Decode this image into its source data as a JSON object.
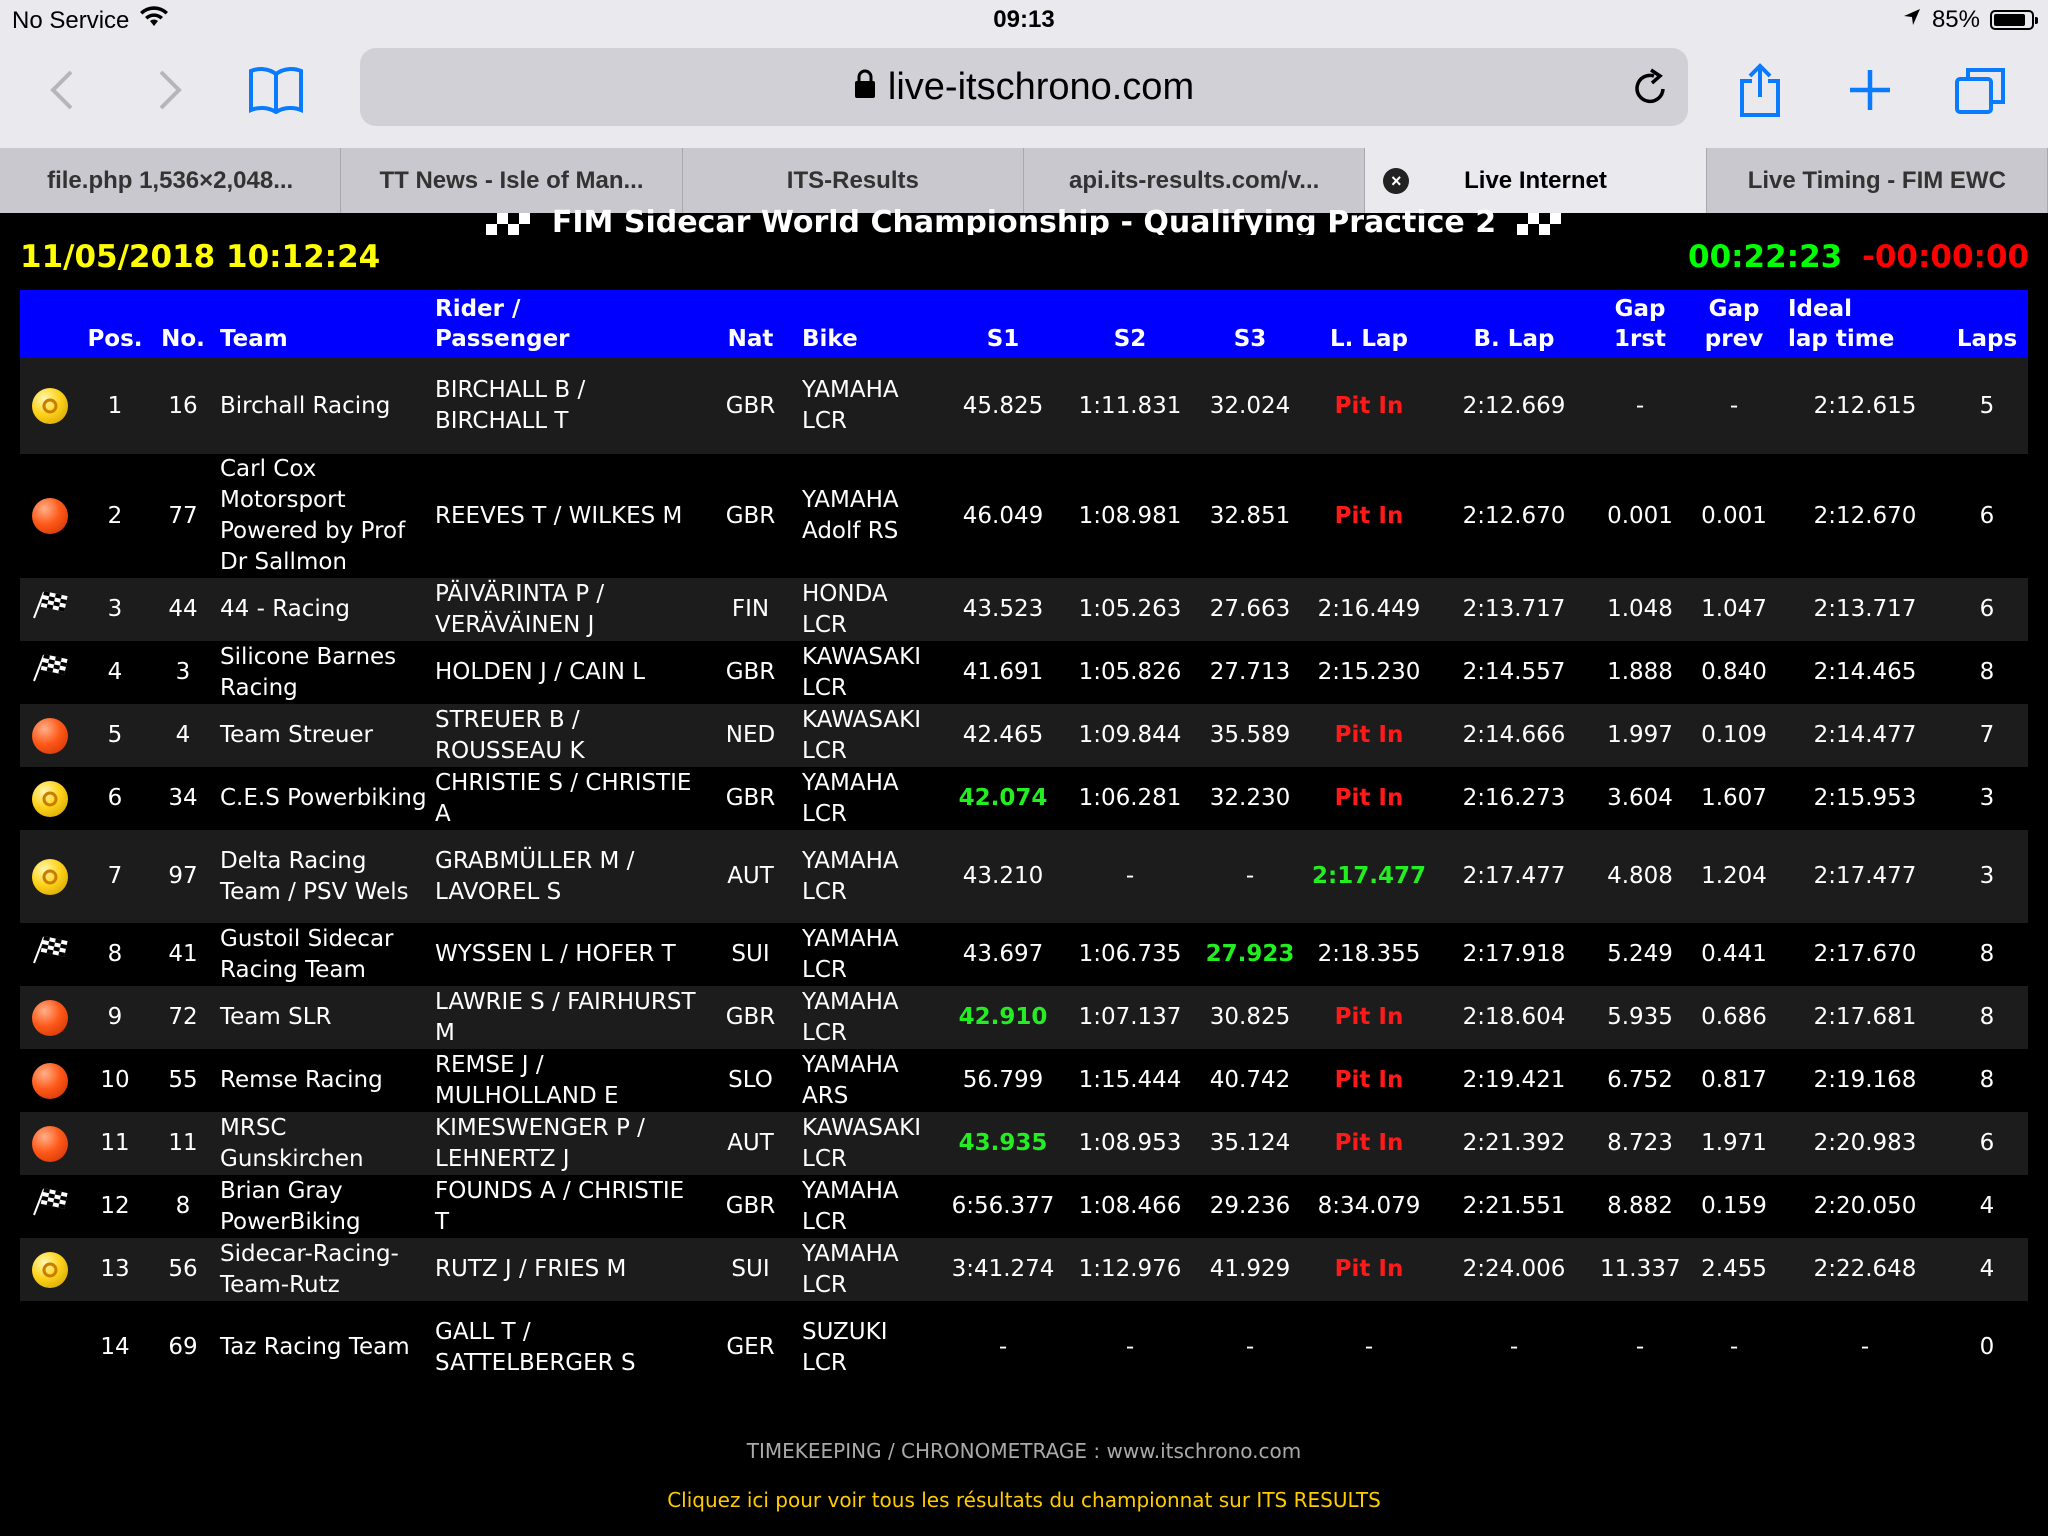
{
  "status_bar": {
    "carrier": "No Service",
    "time": "09:13",
    "battery": "85%",
    "battery_level": 0.85
  },
  "browser": {
    "url": "live-itschrono.com",
    "tabs": [
      {
        "label": "file.php 1,536×2,048..."
      },
      {
        "label": "TT News - Isle of Man..."
      },
      {
        "label": "ITS-Results"
      },
      {
        "label": "api.its-results.com/v..."
      },
      {
        "label": "Live Internet",
        "active": true
      },
      {
        "label": "Live Timing - FIM EWC"
      }
    ]
  },
  "page": {
    "title": "FIM Sidecar World Championship - Qualifying Practice 2",
    "datetime": "11/05/2018 10:12:24",
    "elapsed": "00:22:23",
    "remaining": "-00:00:00",
    "footer_credit": "TIMEKEEPING / CHRONOMETRAGE : www.itschrono.com",
    "footer_link": "Cliquez ici pour voir tous les résultats du championnat sur ITS RESULTS"
  },
  "colors": {
    "header_bg": "#0000ff",
    "date_yellow": "#ffff00",
    "elapsed_green": "#00ff00",
    "remain_red": "#ff0000",
    "pit_red": "#ff1a1a",
    "best_green": "#22ee22"
  },
  "table": {
    "headers": {
      "pos": "Pos.",
      "no": "No.",
      "team": "Team",
      "rider_1": "Rider /",
      "rider_2": "Passenger",
      "nat": "Nat",
      "bike": "Bike",
      "s1": "S1",
      "s2": "S2",
      "s3": "S3",
      "llap": "L. Lap",
      "blap": "B. Lap",
      "gap1_1": "Gap",
      "gap1_2": "1rst",
      "gapp_1": "Gap",
      "gapp_2": "prev",
      "ideal_1": "Ideal",
      "ideal_2": "lap time",
      "laps": "Laps"
    },
    "rows": [
      {
        "status": "yellow-ball-icon",
        "pos": "1",
        "no": "16",
        "team": "Birchall Racing",
        "rider": "BIRCHALL B / BIRCHALL T",
        "nat": "GBR",
        "bike": "YAMAHA LCR",
        "s1": "45.825",
        "s2": "1:11.831",
        "s3": "32.024",
        "llap": "Pit In",
        "blap": "2:12.669",
        "gap1": "-",
        "gapp": "-",
        "ideal": "2:12.615",
        "laps": "5",
        "h": 96,
        "hl": [
          "llap"
        ]
      },
      {
        "status": "red-ball-icon",
        "pos": "2",
        "no": "77",
        "team": "Carl Cox Motorsport Powered by Prof Dr Sallmon",
        "rider": "REEVES T / WILKES M",
        "nat": "GBR",
        "bike": "YAMAHA Adolf RS",
        "s1": "46.049",
        "s2": "1:08.981",
        "s3": "32.851",
        "llap": "Pit In",
        "blap": "2:12.670",
        "gap1": "0.001",
        "gapp": "0.001",
        "ideal": "2:12.670",
        "laps": "6",
        "h": 97,
        "hl": [
          "llap"
        ]
      },
      {
        "status": "checkered-flag-icon",
        "pos": "3",
        "no": "44",
        "team": "44 - Racing",
        "rider": "PÄIVÄRINTA P / VERÄVÄINEN J",
        "nat": "FIN",
        "bike": "HONDA LCR",
        "s1": "43.523",
        "s2": "1:05.263",
        "s3": "27.663",
        "llap": "2:16.449",
        "blap": "2:13.717",
        "gap1": "1.048",
        "gapp": "1.047",
        "ideal": "2:13.717",
        "laps": "6",
        "h": 63,
        "hl": []
      },
      {
        "status": "checkered-flag-icon",
        "pos": "4",
        "no": "3",
        "team": "Silicone Barnes Racing",
        "rider": "HOLDEN J / CAIN L",
        "nat": "GBR",
        "bike": "KAWASAKI LCR",
        "s1": "41.691",
        "s2": "1:05.826",
        "s3": "27.713",
        "llap": "2:15.230",
        "blap": "2:14.557",
        "gap1": "1.888",
        "gapp": "0.840",
        "ideal": "2:14.465",
        "laps": "8",
        "h": 63,
        "hl": []
      },
      {
        "status": "red-ball-icon",
        "pos": "5",
        "no": "4",
        "team": "Team Streuer",
        "rider": "STREUER B / ROUSSEAU K",
        "nat": "NED",
        "bike": "KAWASAKI LCR",
        "s1": "42.465",
        "s2": "1:09.844",
        "s3": "35.589",
        "llap": "Pit In",
        "blap": "2:14.666",
        "gap1": "1.997",
        "gapp": "0.109",
        "ideal": "2:14.477",
        "laps": "7",
        "h": 63,
        "hl": [
          "llap"
        ]
      },
      {
        "status": "yellow-ball-icon",
        "pos": "6",
        "no": "34",
        "team": "C.E.S Powerbiking",
        "rider": "CHRISTIE S / CHRISTIE A",
        "nat": "GBR",
        "bike": "YAMAHA LCR",
        "s1": "42.074",
        "s2": "1:06.281",
        "s3": "32.230",
        "llap": "Pit In",
        "blap": "2:16.273",
        "gap1": "3.604",
        "gapp": "1.607",
        "ideal": "2:15.953",
        "laps": "3",
        "h": 63,
        "hl": [
          "s1g",
          "llap"
        ]
      },
      {
        "status": "yellow-ball-icon",
        "pos": "7",
        "no": "97",
        "team": "Delta Racing Team / PSV Wels",
        "rider": "GRABMÜLLER M / LAVOREL S",
        "nat": "AUT",
        "bike": "YAMAHA LCR",
        "s1": "43.210",
        "s2": "-",
        "s3": "-",
        "llap": "2:17.477",
        "blap": "2:17.477",
        "gap1": "4.808",
        "gapp": "1.204",
        "ideal": "2:17.477",
        "laps": "3",
        "h": 93,
        "hl": [
          "llapg"
        ]
      },
      {
        "status": "checkered-flag-icon",
        "pos": "8",
        "no": "41",
        "team": "Gustoil Sidecar Racing Team",
        "rider": "WYSSEN L / HOFER T",
        "nat": "SUI",
        "bike": "YAMAHA LCR",
        "s1": "43.697",
        "s2": "1:06.735",
        "s3": "27.923",
        "llap": "2:18.355",
        "blap": "2:17.918",
        "gap1": "5.249",
        "gapp": "0.441",
        "ideal": "2:17.670",
        "laps": "8",
        "h": 63,
        "hl": [
          "s3g"
        ]
      },
      {
        "status": "red-ball-icon",
        "pos": "9",
        "no": "72",
        "team": "Team SLR",
        "rider": "LAWRIE S / FAIRHURST M",
        "nat": "GBR",
        "bike": "YAMAHA LCR",
        "s1": "42.910",
        "s2": "1:07.137",
        "s3": "30.825",
        "llap": "Pit In",
        "blap": "2:18.604",
        "gap1": "5.935",
        "gapp": "0.686",
        "ideal": "2:17.681",
        "laps": "8",
        "h": 63,
        "hl": [
          "s1g",
          "llap"
        ]
      },
      {
        "status": "red-ball-icon",
        "pos": "10",
        "no": "55",
        "team": "Remse Racing",
        "rider": "REMSE J / MULHOLLAND E",
        "nat": "SLO",
        "bike": "YAMAHA ARS",
        "s1": "56.799",
        "s2": "1:15.444",
        "s3": "40.742",
        "llap": "Pit In",
        "blap": "2:19.421",
        "gap1": "6.752",
        "gapp": "0.817",
        "ideal": "2:19.168",
        "laps": "8",
        "h": 63,
        "hl": [
          "llap"
        ]
      },
      {
        "status": "red-ball-icon",
        "pos": "11",
        "no": "11",
        "team": "MRSC Gunskirchen",
        "rider": "KIMESWENGER P / LEHNERTZ J",
        "nat": "AUT",
        "bike": "KAWASAKI LCR",
        "s1": "43.935",
        "s2": "1:08.953",
        "s3": "35.124",
        "llap": "Pit In",
        "blap": "2:21.392",
        "gap1": "8.723",
        "gapp": "1.971",
        "ideal": "2:20.983",
        "laps": "6",
        "h": 63,
        "hl": [
          "s1g",
          "llap"
        ]
      },
      {
        "status": "checkered-flag-icon",
        "pos": "12",
        "no": "8",
        "team": "Brian Gray PowerBiking",
        "rider": "FOUNDS A / CHRISTIE T",
        "nat": "GBR",
        "bike": "YAMAHA LCR",
        "s1": "6:56.377",
        "s2": "1:08.466",
        "s3": "29.236",
        "llap": "8:34.079",
        "blap": "2:21.551",
        "gap1": "8.882",
        "gapp": "0.159",
        "ideal": "2:20.050",
        "laps": "4",
        "h": 63,
        "hl": []
      },
      {
        "status": "yellow-ball-icon",
        "pos": "13",
        "no": "56",
        "team": "Sidecar-Racing-Team-Rutz",
        "rider": "RUTZ J / FRIES M",
        "nat": "SUI",
        "bike": "YAMAHA LCR",
        "s1": "3:41.274",
        "s2": "1:12.976",
        "s3": "41.929",
        "llap": "Pit In",
        "blap": "2:24.006",
        "gap1": "11.337",
        "gapp": "2.455",
        "ideal": "2:22.648",
        "laps": "4",
        "h": 63,
        "hl": [
          "llap"
        ]
      },
      {
        "status": "",
        "pos": "14",
        "no": "69",
        "team": "Taz Racing Team",
        "rider": "GALL T / SATTELBERGER S",
        "nat": "GER",
        "bike": "SUZUKI LCR",
        "s1": "-",
        "s2": "-",
        "s3": "-",
        "llap": "-",
        "blap": "-",
        "gap1": "-",
        "gapp": "-",
        "ideal": "-",
        "laps": "0",
        "h": 93,
        "hl": []
      }
    ]
  }
}
